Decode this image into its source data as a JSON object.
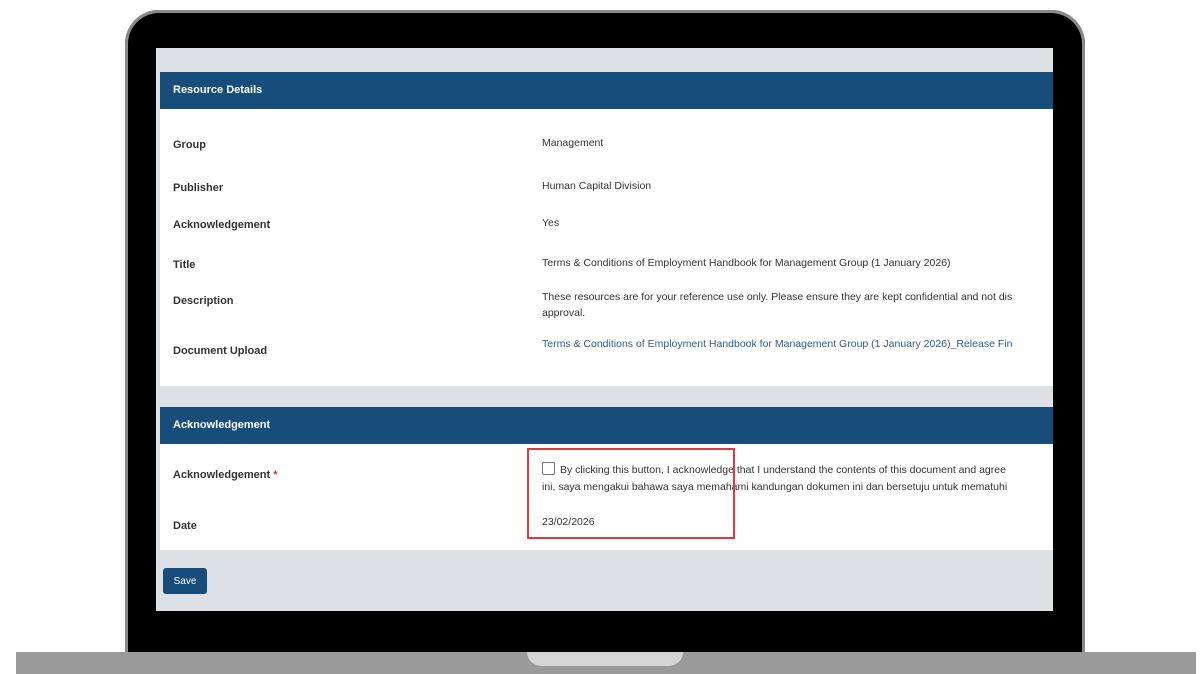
{
  "resource_details": {
    "header": "Resource Details",
    "rows": [
      {
        "label": "Group",
        "value": "Management"
      },
      {
        "label": "Publisher",
        "value": "Human Capital Division"
      },
      {
        "label": "Acknowledgement",
        "value": "Yes"
      },
      {
        "label": "Title",
        "value": "Terms & Conditions of Employment Handbook for Management Group (1 January 2026)"
      },
      {
        "label": "Description",
        "value": "These resources are for your reference use only. Please ensure they are kept confidential and not dis"
      },
      {
        "label": "Document Upload",
        "value": "Terms & Conditions of Employment Handbook for Management Group (1 January 2026)_Release Fin"
      }
    ],
    "description_line2": "approval."
  },
  "acknowledgement_section": {
    "header": "Acknowledgement",
    "ack_label": "Acknowledgement",
    "required_mark": "*",
    "checkbox_line1": "By clicking this button, I acknowledge that I understand the contents of this document and agree",
    "checkbox_line2": "ini, saya mengakui bahawa saya memahami kandungan dokumen ini dan bersetuju untuk mematuhi",
    "checkbox_checked": false,
    "date_label": "Date",
    "date_value": "23/02/2026"
  },
  "save_label": "Save",
  "colors": {
    "header_bg": "#174d7a",
    "highlight": "#e23a3a",
    "required": "#e03030",
    "link": "#2b5f91"
  }
}
